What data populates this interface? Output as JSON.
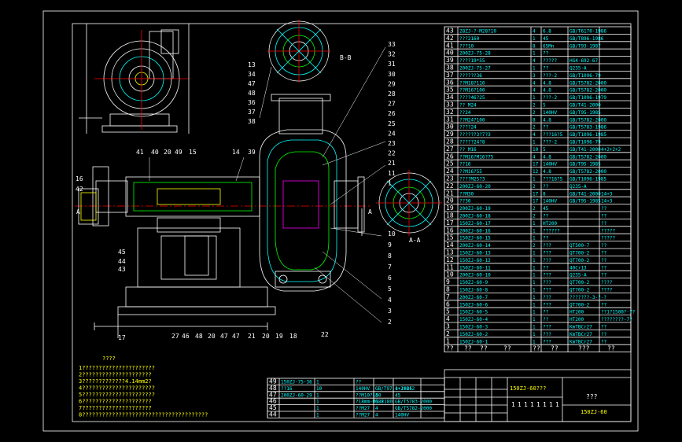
{
  "section_labels": {
    "A_left": "A",
    "A_right": "A",
    "A_arrow": "A-A",
    "B_arrow": "B-B"
  },
  "balloons_top_right": [
    "33",
    "32",
    "31",
    "30",
    "29",
    "28",
    "27",
    "26",
    "25",
    "24",
    "23",
    "22",
    "21",
    "11",
    "1"
  ],
  "balloons_right": [
    "10",
    "9",
    "8",
    "7",
    "6",
    "5",
    "4",
    "3",
    "2"
  ],
  "balloons_top_left": [
    "13",
    "34",
    "47",
    "48",
    "36",
    "37",
    "38"
  ],
  "balloons_mid": [
    "41",
    "40",
    "20",
    "49",
    "15",
    "14",
    "39"
  ],
  "balloons_left": [
    "16",
    "42",
    "45",
    "44",
    "43",
    "17"
  ],
  "balloons_bottom": [
    "27",
    "46",
    "48",
    "20",
    "47",
    "47",
    "21",
    "20",
    "19",
    "18",
    "22"
  ],
  "notes_title": "????",
  "notes": [
    "1??????????????????????",
    "2?????????????????????",
    "3?????????????4.14mm2?",
    "4??????????????????????",
    "5??????????????????????",
    "6?????????????????????",
    "7?????????????????????",
    "8??????????????????????????????????????"
  ],
  "bom_rows": [
    [
      "43",
      "28ZJ-?-M28?10",
      "4",
      "6.8",
      "GB/T6170-1986",
      ""
    ],
    [
      "42",
      "???2160",
      "1",
      "45",
      "GB/T896-1986",
      ""
    ],
    [
      "41",
      "???10",
      "8",
      "65Mn",
      "GB/T93-1987",
      ""
    ],
    [
      "40",
      "200ZJ-75-28",
      "1",
      "??",
      "",
      ""
    ],
    [
      "39",
      "????19*55",
      "4",
      "?????",
      "HG4-692-67",
      ""
    ],
    [
      "38",
      "200ZJ-75-27",
      "1",
      "??",
      "Q235-A",
      ""
    ],
    [
      "37",
      "??????36",
      "3",
      "???-2",
      "GB/T1096-79",
      ""
    ],
    [
      "36",
      "??M18?110",
      "4",
      "4.8",
      "GB/T5782-2000",
      ""
    ],
    [
      "35",
      "??M16?100",
      "4",
      "4.8",
      "GB/T5782-2000",
      ""
    ],
    [
      "34",
      "????46?25",
      "1",
      "???-2",
      "GB/T1096-1979",
      ""
    ],
    [
      "33",
      "?? M24",
      "2",
      "5",
      "GB/T41-2000",
      ""
    ],
    [
      "32",
      "??24",
      "2",
      "140HV",
      "GB/T95-1985",
      ""
    ],
    [
      "31",
      "??M24?100",
      "8",
      "4.8",
      "GB/T5782-2000",
      ""
    ],
    [
      "30",
      "????24",
      "2",
      "??",
      "GB/T5783-1986",
      ""
    ],
    [
      "29",
      "??????3?7?3",
      "4",
      "???16?5",
      "GB/T1096-1985",
      ""
    ],
    [
      "28",
      "?????24?8",
      "1",
      "???-2",
      "GB/T1096-79",
      ""
    ],
    [
      "27",
      "?? M16",
      "10",
      "5",
      "GB/T41-2000",
      "4+2+2+2"
    ],
    [
      "26",
      "??M16?M16?75",
      "4",
      "4.8",
      "GB/T5782-2000",
      ""
    ],
    [
      "25",
      "??16",
      "17",
      "140HV",
      "GB/T95-1985",
      ""
    ],
    [
      "24",
      "??M16?55",
      "12",
      "4.8",
      "GB/T5782-2000",
      ""
    ],
    [
      "23",
      "????M25?3",
      "1",
      "???16?5",
      "GB/T1096-1985",
      ""
    ],
    [
      "22",
      "200ZJ-60-20",
      "2",
      "??",
      "Q235-A",
      ""
    ],
    [
      "21",
      "??M30",
      "17",
      "8",
      "GB/T41-2000",
      "14+3"
    ],
    [
      "20",
      "??30",
      "17",
      "140HV",
      "GB/T95-1985",
      "14+3"
    ],
    [
      "19",
      "200ZJ-60-19",
      "2",
      "45",
      "",
      "??"
    ],
    [
      "18",
      "200ZJ-60-18",
      "2",
      "??",
      "",
      "??"
    ],
    [
      "17",
      "150ZJ-60-17",
      "1",
      "HT200",
      "",
      "??"
    ],
    [
      "16",
      "200ZJ-60-16",
      "1",
      "??????",
      "",
      "?????"
    ],
    [
      "15",
      "150ZJ-60-15",
      "1",
      "??",
      "",
      "?????"
    ],
    [
      "14",
      "200ZJ-60-14",
      "2",
      "???",
      "QT500-7",
      "??"
    ],
    [
      "13",
      "150ZJ-60-13",
      "1",
      "???",
      "QT700-2",
      "??"
    ],
    [
      "12",
      "150ZJ-60-12",
      "1",
      "???",
      "QT700-2",
      "??"
    ],
    [
      "11",
      "150ZJ-60-11",
      "1",
      "??",
      "40Cr13",
      "??"
    ],
    [
      "10",
      "200ZJ-60-10",
      "1",
      "???",
      "Q235-A",
      "??"
    ],
    [
      "9",
      "150ZJ-60-9",
      "1",
      "???",
      "QT700-2",
      "????"
    ],
    [
      "8",
      "150ZJ-60-8",
      "1",
      "???",
      "QT700-2",
      "????"
    ],
    [
      "7",
      "200ZJ-60-7",
      "1",
      "???",
      "???????-3-?-?",
      ""
    ],
    [
      "6",
      "150ZJ-60-6",
      "1",
      "???",
      "QT700-2",
      "??"
    ],
    [
      "5",
      "150ZJ-60-5",
      "1",
      "??",
      "HT200",
      "??1?1500?-7?"
    ],
    [
      "4",
      "150ZJ-60-4",
      "1",
      "??",
      "HT200",
      "????????-7?"
    ],
    [
      "3",
      "150ZJ-60-3",
      "1",
      "???",
      "KmTBCr27",
      "??"
    ],
    [
      "2",
      "150ZJ-60-2",
      "1",
      "???",
      "KmTBCr27",
      "??"
    ],
    [
      "1",
      "150ZJ-60-1",
      "1",
      "???",
      "KmTBCr27",
      "??"
    ]
  ],
  "bom_header": [
    "??",
    "??",
    "??",
    "??",
    "??",
    "??",
    "???",
    "??"
  ],
  "bottom_bom_rows": [
    [
      "49",
      "150ZJ-75-36",
      "1",
      "??",
      "",
      ""
    ],
    [
      "48",
      "??16",
      "10",
      "140HV",
      "GB/T97.1-1985",
      "4+2+2+2"
    ],
    [
      "47",
      "200ZJ-60-29",
      "1",
      "??M10?150",
      "4",
      "45"
    ],
    [
      "46",
      "",
      "1",
      "?18mm-M18?180",
      "6.8",
      "GB/T5783-2000"
    ],
    [
      "45",
      "",
      "1",
      "??M27",
      "4",
      "GB/T5782-2000"
    ],
    [
      "44",
      "",
      "1",
      "??M27",
      "4",
      "140HV"
    ]
  ],
  "title_block": {
    "drawing_title": "150ZJ-60???",
    "owner": "???",
    "drawing_no": "150ZJ-60",
    "scale_cells": [
      "1",
      "1",
      "1",
      "1",
      "1",
      "1",
      "1",
      "1"
    ]
  }
}
